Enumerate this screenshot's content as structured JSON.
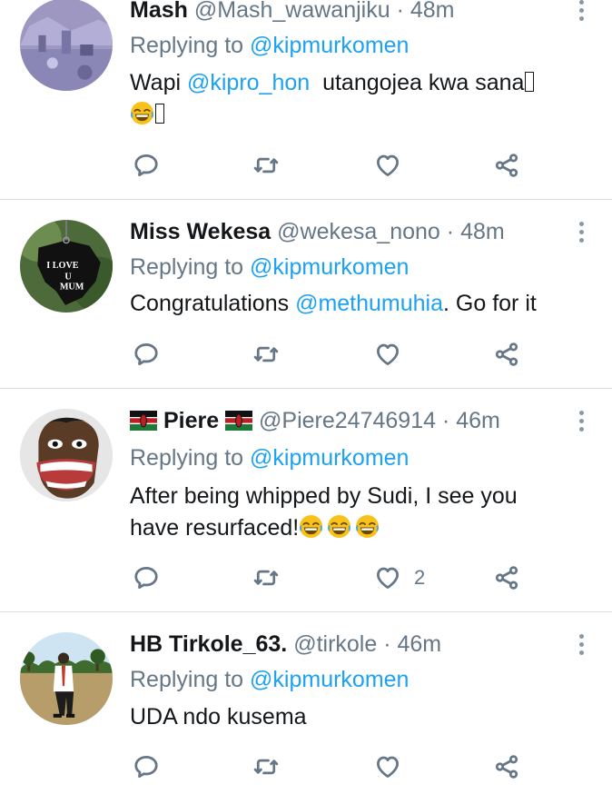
{
  "tweets": [
    {
      "name": "Mash",
      "handle": "@Mash_wawanjiku",
      "dot": "·",
      "time": "48m",
      "replying_prefix": "Replying to",
      "replying_to": "@kipmurkomen",
      "text_before": "Wapi ",
      "mention": "@kipro_hon",
      "text_after": "  utangojea kwa sana",
      "likes": ""
    },
    {
      "name": "Miss Wekesa",
      "handle": "@wekesa_nono",
      "dot": "·",
      "time": "48m",
      "replying_prefix": "Replying to",
      "replying_to": "@kipmurkomen",
      "text_before": "Congratulations ",
      "mention": "@methumuhia",
      "text_after": ". Go for it",
      "avatar_text": [
        "I LOVE",
        "U",
        "MUM"
      ],
      "likes": ""
    },
    {
      "name": "Piere",
      "handle": "@Piere24746914",
      "dot": "·",
      "time": "46m",
      "replying_prefix": "Replying to",
      "replying_to": "@kipmurkomen",
      "text_line1": "After being whipped by Sudi, I see you",
      "text_line2": "have resurfaced!",
      "likes": "2"
    },
    {
      "name": "HB Tirkole_63.",
      "handle": "@tirkole",
      "dot": "·",
      "time": "46m",
      "replying_prefix": "Replying to",
      "replying_to": "@kipmurkomen",
      "text": "UDA ndo kusema",
      "likes": ""
    }
  ],
  "icons": {
    "reply": "reply-icon",
    "retweet": "retweet-icon",
    "like": "heart-icon",
    "share": "share-icon",
    "more": "more-vertical-icon"
  },
  "colors": {
    "link": "#1da1f2",
    "secondary": "#657786",
    "divider": "#d9dde0"
  }
}
